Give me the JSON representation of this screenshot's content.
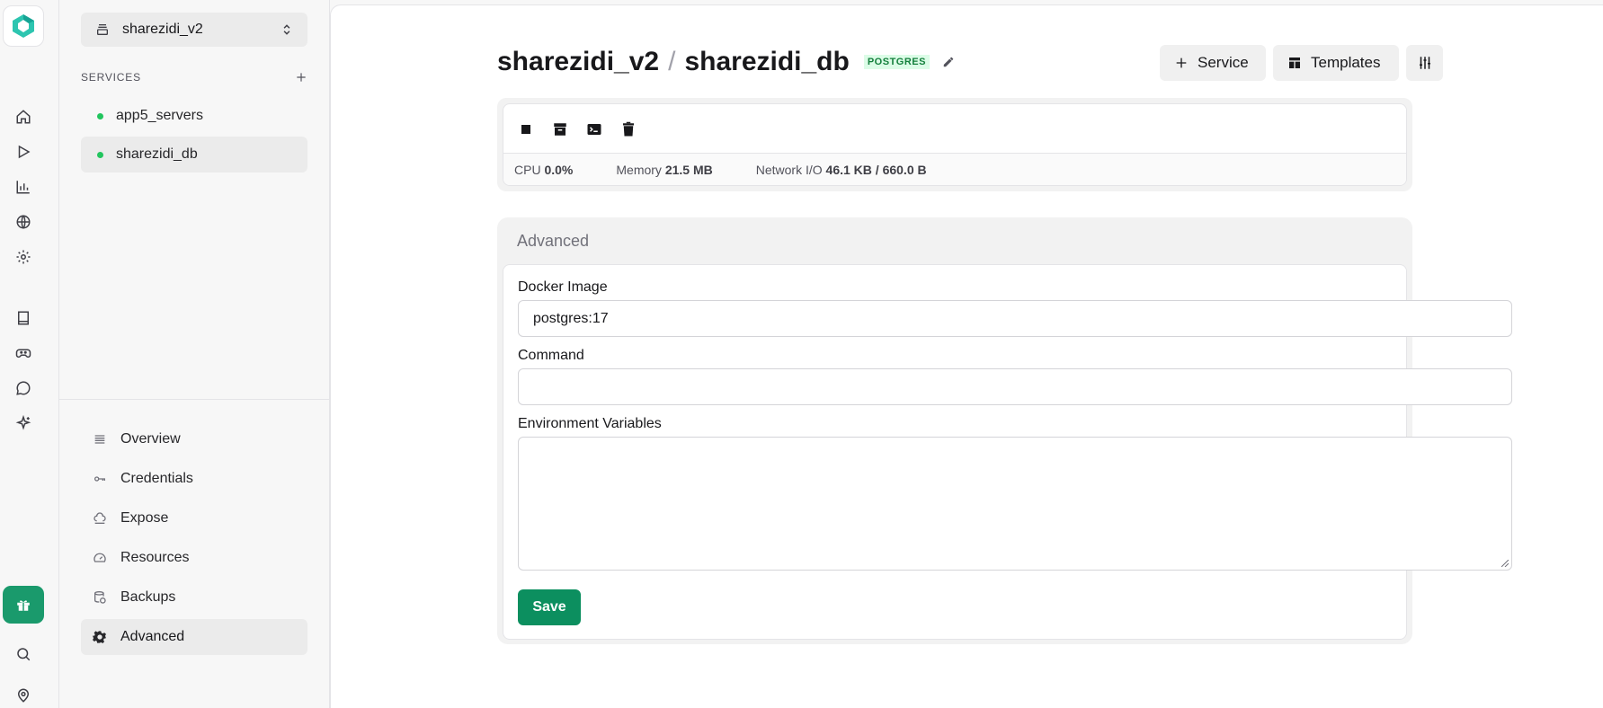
{
  "project": {
    "name": "sharezidi_v2"
  },
  "services": {
    "header": "SERVICES",
    "items": [
      {
        "name": "app5_servers",
        "status_color": "#22c55e"
      },
      {
        "name": "sharezidi_db",
        "status_color": "#22c55e"
      }
    ]
  },
  "nav": {
    "items": [
      {
        "label": "Overview",
        "icon": "list-icon"
      },
      {
        "label": "Credentials",
        "icon": "key-icon"
      },
      {
        "label": "Expose",
        "icon": "cloud-upload-icon"
      },
      {
        "label": "Resources",
        "icon": "gauge-icon"
      },
      {
        "label": "Backups",
        "icon": "database-backup-icon"
      },
      {
        "label": "Advanced",
        "icon": "gear-icon"
      }
    ],
    "active": "Advanced"
  },
  "header": {
    "project": "sharezidi_v2",
    "separator": "/",
    "service": "sharezidi_db",
    "badge": "POSTGRES",
    "service_button": "Service",
    "templates_button": "Templates"
  },
  "metrics": {
    "cpu_label": "CPU",
    "cpu_value": "0.0%",
    "memory_label": "Memory",
    "memory_value": "21.5 MB",
    "network_label": "Network I/O",
    "network_value": "46.1 KB / 660.0 B"
  },
  "advanced": {
    "title": "Advanced",
    "docker_image_label": "Docker Image",
    "docker_image_value": "postgres:17",
    "command_label": "Command",
    "command_value": "",
    "env_label": "Environment Variables",
    "env_value": "",
    "save_label": "Save"
  },
  "colors": {
    "accent": "#0c8f5f",
    "status_running": "#22c55e",
    "badge_bg": "#dcfce7",
    "badge_text": "#15803d"
  }
}
